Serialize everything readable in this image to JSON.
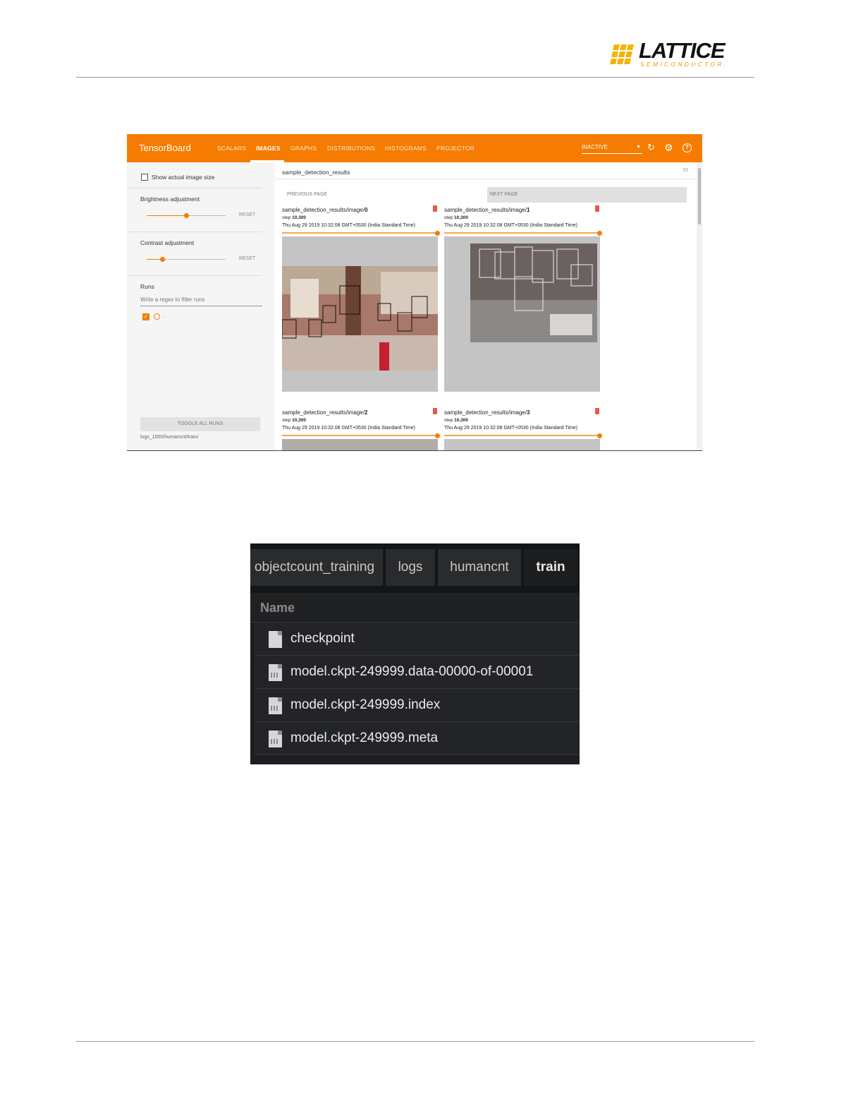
{
  "page": {
    "logo": {
      "word": "LATTICE",
      "sub": "SEMICONDUCTOR."
    }
  },
  "tensorboard": {
    "brand": "TensorBoard",
    "nav": [
      "SCALARS",
      "IMAGES",
      "GRAPHS",
      "DISTRIBUTIONS",
      "HISTOGRAMS",
      "PROJECTOR"
    ],
    "active_tab": "IMAGES",
    "status": "INACTIVE",
    "colors": {
      "accent": "#f57c00",
      "badge": "#e8554a"
    },
    "icons": [
      "refresh-icon",
      "settings-icon",
      "help-icon"
    ],
    "sidebar": {
      "show_actual_size": "Show actual image size",
      "show_actual_size_checked": false,
      "brightness_label": "Brightness adjustment",
      "brightness_level": 0.5,
      "contrast_label": "Contrast adjustment",
      "contrast_level": 0.2,
      "reset_label": "RESET",
      "runs_label": "Runs",
      "regex_placeholder": "Write a regex to filter runs",
      "run_name": ".",
      "toggle_all": "TOGGLE ALL RUNS",
      "logdir": "logs_1000/humancnt/train/"
    },
    "main": {
      "tag": "sample_detection_results",
      "count": "20",
      "prev_page": "PREVIOUS PAGE",
      "next_page": "NEXT PAGE",
      "cards": [
        {
          "prefix": "sample_detection_results/image/",
          "index": "0",
          "step_label": "step",
          "step": "10,300",
          "date": "Thu Aug 29 2019 10:32:08 GMT+0530 (India Standard Time)"
        },
        {
          "prefix": "sample_detection_results/image/",
          "index": "1",
          "step_label": "step",
          "step": "10,300",
          "date": "Thu Aug 29 2019 10:32:08 GMT+0530 (India Standard Time)"
        },
        {
          "prefix": "sample_detection_results/image/",
          "index": "2",
          "step_label": "step",
          "step": "10,300",
          "date": "Thu Aug 29 2019 10:32:08 GMT+0530 (India Standard Time)"
        },
        {
          "prefix": "sample_detection_results/image/",
          "index": "3",
          "step_label": "step",
          "step": "10,300",
          "date": "Thu Aug 29 2019 10:32:08 GMT+0530 (India Standard Time)"
        }
      ]
    }
  },
  "file_browser": {
    "breadcrumbs": [
      "objectcount_training",
      "logs",
      "humancnt",
      "train"
    ],
    "active_crumb": "train",
    "column_header": "Name",
    "files": [
      {
        "name": "checkpoint",
        "icon": "text-file-icon"
      },
      {
        "name": "model.ckpt-249999.data-00000-of-00001",
        "icon": "binary-file-icon"
      },
      {
        "name": "model.ckpt-249999.index",
        "icon": "binary-file-icon"
      },
      {
        "name": "model.ckpt-249999.meta",
        "icon": "binary-file-icon"
      }
    ]
  }
}
